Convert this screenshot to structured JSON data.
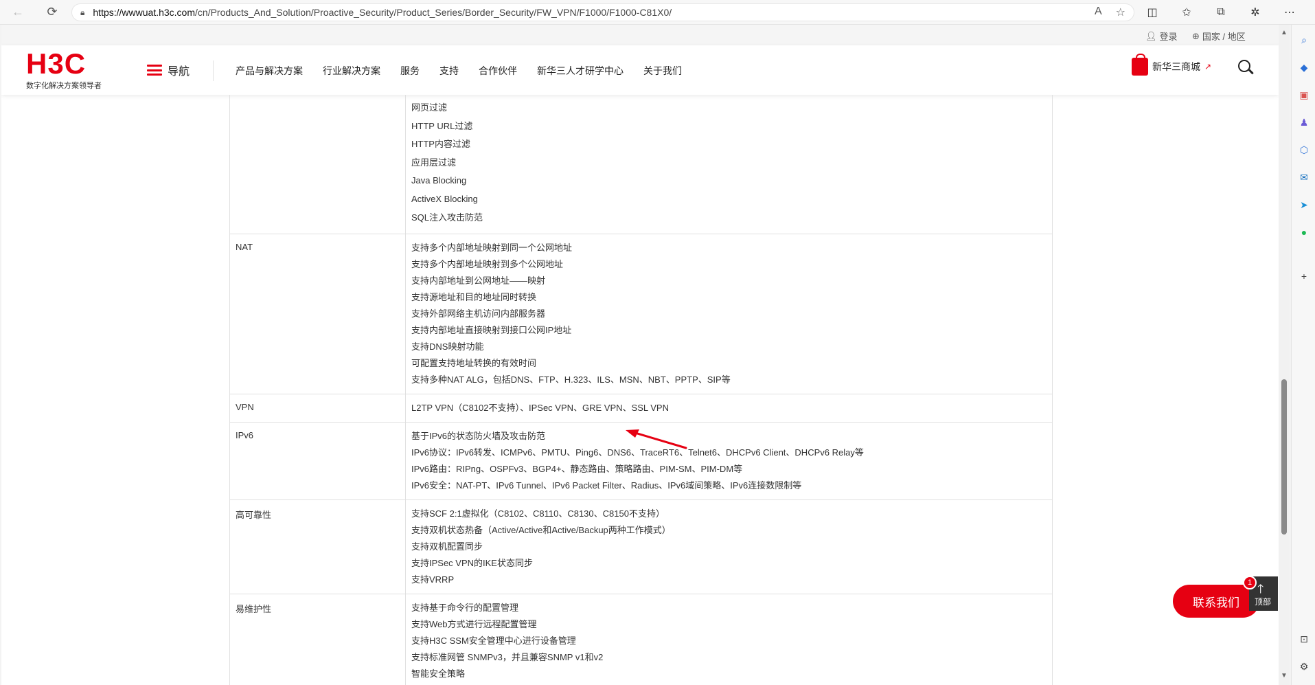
{
  "browser": {
    "url_host": "https://wwwuat.h3c.com",
    "url_path": "/cn/Products_And_Solution/Proactive_Security/Product_Series/Border_Security/FW_VPN/F1000/F1000-C81X0/"
  },
  "utility": {
    "login": "登录",
    "region": "国家 / 地区"
  },
  "header": {
    "logo_text": "H3C",
    "slogan": "数字化解决方案领导者",
    "menu_label": "导航",
    "nav": [
      "产品与解决方案",
      "行业解决方案",
      "服务",
      "支持",
      "合作伙伴",
      "新华三人才研学中心",
      "关于我们"
    ],
    "shop_label": "新华三商城"
  },
  "table": {
    "top_rows": [
      "网页过滤",
      "HTTP URL过滤",
      "HTTP内容过滤",
      "应用层过滤",
      "Java Blocking",
      "ActiveX Blocking",
      "SQL注入攻击防范"
    ],
    "rows": [
      {
        "key": "NAT",
        "lines": [
          "支持多个内部地址映射到同一个公网地址",
          "支持多个内部地址映射到多个公网地址",
          "支持内部地址到公网地址——映射",
          "支持源地址和目的地址同时转换",
          "支持外部网络主机访问内部服务器",
          "支持内部地址直接映射到接口公网IP地址",
          "支持DNS映射功能",
          "可配置支持地址转换的有效时间",
          "支持多种NAT ALG，包括DNS、FTP、H.323、ILS、MSN、NBT、PPTP、SIP等"
        ]
      },
      {
        "key": "VPN",
        "lines": [
          "L2TP VPN（C8102不支持）、IPSec VPN、GRE VPN、SSL VPN"
        ]
      },
      {
        "key": "IPv6",
        "lines": [
          "基于IPv6的状态防火墙及攻击防范",
          "IPv6协议：IPv6转发、ICMPv6、PMTU、Ping6、DNS6、TraceRT6、Telnet6、DHCPv6 Client、DHCPv6 Relay等",
          "IPv6路由：RIPng、OSPFv3、BGP4+、静态路由、策略路由、PIM-SM、PIM-DM等",
          "IPv6安全：NAT-PT、IPv6 Tunnel、IPv6 Packet Filter、Radius、IPv6域间策略、IPv6连接数限制等"
        ]
      },
      {
        "key": "高可靠性",
        "lines": [
          "支持SCF 2:1虚拟化（C8102、C8110、C8130、C8150不支持）",
          "支持双机状态热备（Active/Active和Active/Backup两种工作模式）",
          "支持双机配置同步",
          "支持IPSec VPN的IKE状态同步",
          "支持VRRP"
        ]
      },
      {
        "key": "易维护性",
        "lines": [
          "支持基于命令行的配置管理",
          "支持Web方式进行远程配置管理",
          "支持H3C SSM安全管理中心进行设备管理",
          "支持标准网管 SNMPv3，并且兼容SNMP v1和v2",
          "智能安全策略"
        ]
      }
    ]
  },
  "floating": {
    "contact_label": "联系我们",
    "top_label": "顶部",
    "badge_count": "1"
  },
  "colors": {
    "brand": "#e60012",
    "border": "#e0e0e0"
  },
  "icons": {
    "back": "back-arrow-icon",
    "refresh": "refresh-icon",
    "lock": "lock-icon",
    "read_aloud": "read-aloud-icon",
    "favorite": "star-icon",
    "search": "search-icon"
  }
}
